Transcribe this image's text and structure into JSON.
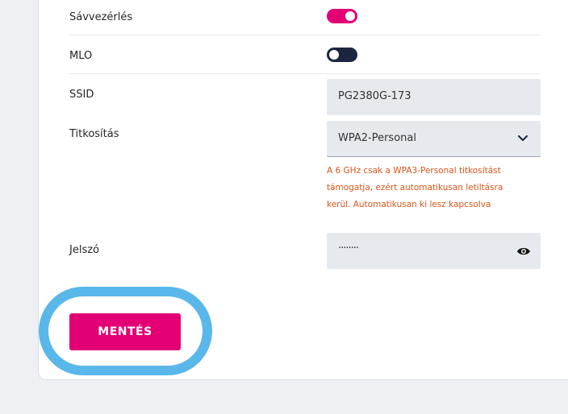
{
  "settings": {
    "band_steering": {
      "label": "Sávvezérlés",
      "enabled": true
    },
    "mlo": {
      "label": "MLO",
      "enabled": false
    },
    "ssid": {
      "label": "SSID",
      "value": "PG2380G-173"
    },
    "encryption": {
      "label": "Titkosítás",
      "value": "WPA2-Personal",
      "warning_lines": [
        "A 6 GHz csak a WPA3-Personal titkosítást",
        "támogatja, ezért automatikusan letiltásra",
        "kerül. Automatikusan ki lesz kapcsolva"
      ]
    },
    "password": {
      "label": "Jelszó",
      "value": "········"
    }
  },
  "actions": {
    "save_label": "MENTÉS"
  },
  "colors": {
    "accent": "#e20074",
    "toggle_off": "#1c2540",
    "warning": "#d9541a",
    "highlight": "#5ab7ea"
  },
  "icons": {
    "dropdown": "chevron-down-icon",
    "reveal": "eye-icon"
  }
}
